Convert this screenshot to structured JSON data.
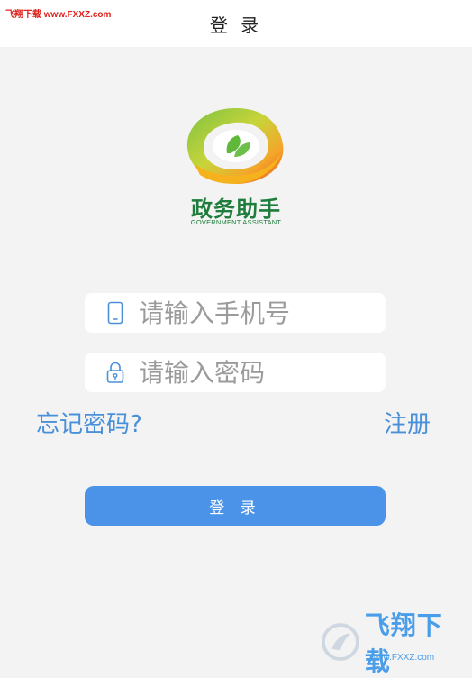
{
  "watermark_top": "飞翔下载 www.FXXZ.com",
  "header": {
    "title": "登 录"
  },
  "logo": {
    "name_cn": "政务助手",
    "name_en": "GOVERNMENT ASSISTANT"
  },
  "form": {
    "phone": {
      "placeholder": "请输入手机号",
      "value": "",
      "icon": "phone-icon"
    },
    "password": {
      "placeholder": "请输入密码",
      "value": "",
      "icon": "lock-icon"
    },
    "forgot_label": "忘记密码?",
    "register_label": "注册",
    "login_label": "登 录"
  },
  "watermark_bottom": {
    "cn": "飞翔下载",
    "en": "www.FXXZ.com"
  },
  "colors": {
    "accent": "#4b93e8",
    "link": "#4a90d9",
    "logo_green": "#1e7d3c",
    "background": "#f3f3f3"
  }
}
